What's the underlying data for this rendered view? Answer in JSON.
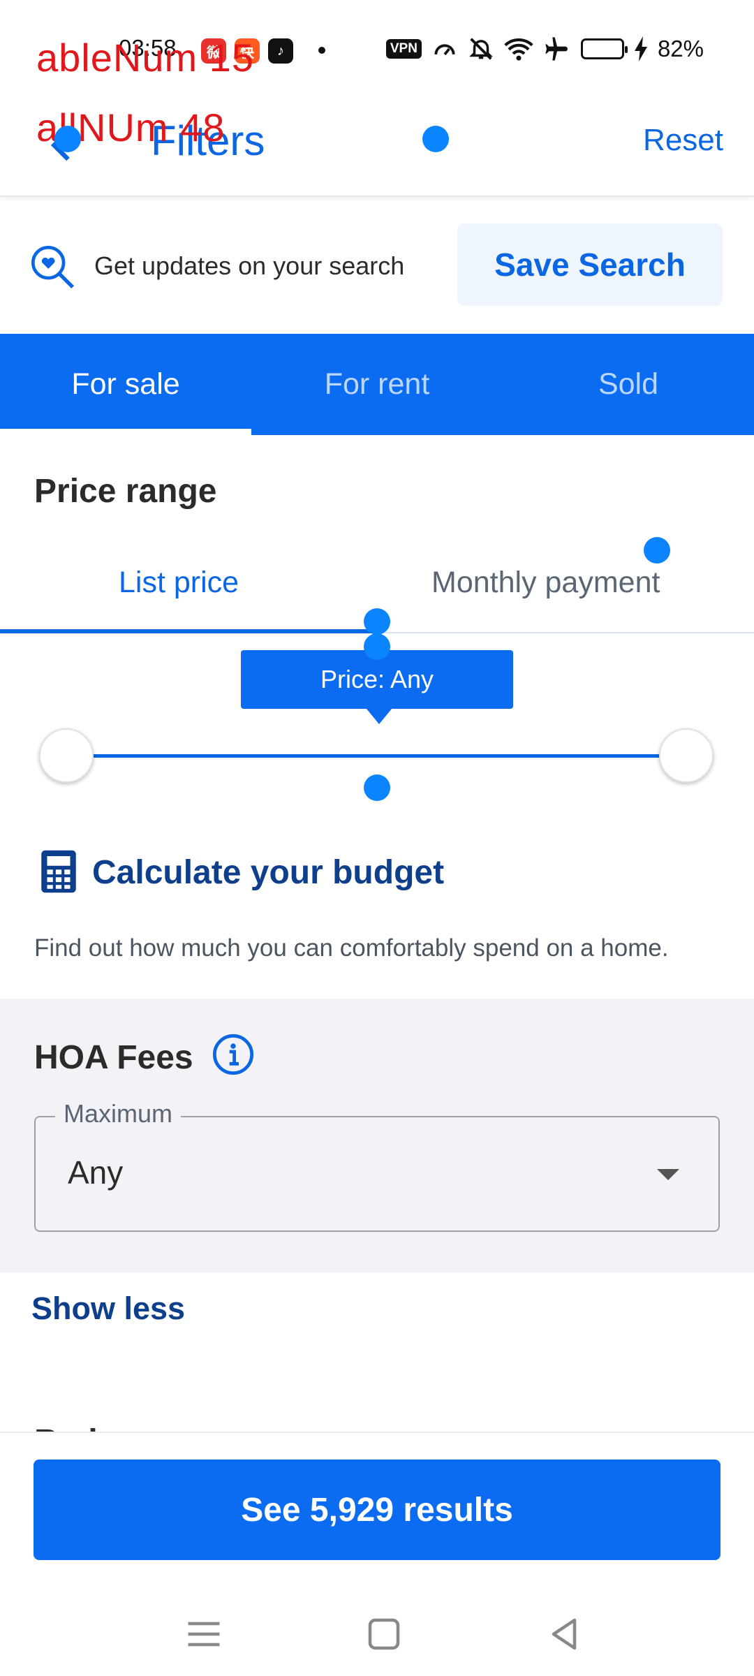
{
  "status_bar": {
    "time": "03:58",
    "battery": "82%",
    "vpn_label": "VPN",
    "battery_level": 0.82,
    "icons": [
      "weibo-app-icon",
      "kuaishou-app-icon",
      "music-app-icon",
      "vpn-icon",
      "speed-icon",
      "mute-icon",
      "wifi-icon",
      "airplane-icon",
      "battery-icon",
      "charging-icon"
    ]
  },
  "overlay": {
    "line1": "ableNum 15",
    "line2": "allNUm 48"
  },
  "header": {
    "title": "Filters",
    "reset_label": "Reset"
  },
  "save_search": {
    "text": "Get updates on your search",
    "button_label": "Save Search"
  },
  "listing_tabs": [
    {
      "label": "For sale",
      "active": true
    },
    {
      "label": "For rent",
      "active": false
    },
    {
      "label": "Sold",
      "active": false
    }
  ],
  "price_range": {
    "title": "Price range",
    "tabs": [
      {
        "label": "List price",
        "active": true
      },
      {
        "label": "Monthly payment",
        "active": false
      }
    ],
    "tooltip": "Price: Any"
  },
  "budget": {
    "title": "Calculate your budget",
    "description": "Find out how much you can comfortably spend on a home."
  },
  "hoa": {
    "title": "HOA Fees",
    "field_label": "Maximum",
    "value": "Any"
  },
  "show_less_label": "Show less",
  "next_section_title": "Bedrooms",
  "cta_label": "See 5,929 results",
  "colors": {
    "primary": "#0b6cf2",
    "link": "#0b66e4",
    "dark_link": "#0e3f8c",
    "overlay_text": "#e0181b",
    "touch_dot": "#0a84ff"
  }
}
